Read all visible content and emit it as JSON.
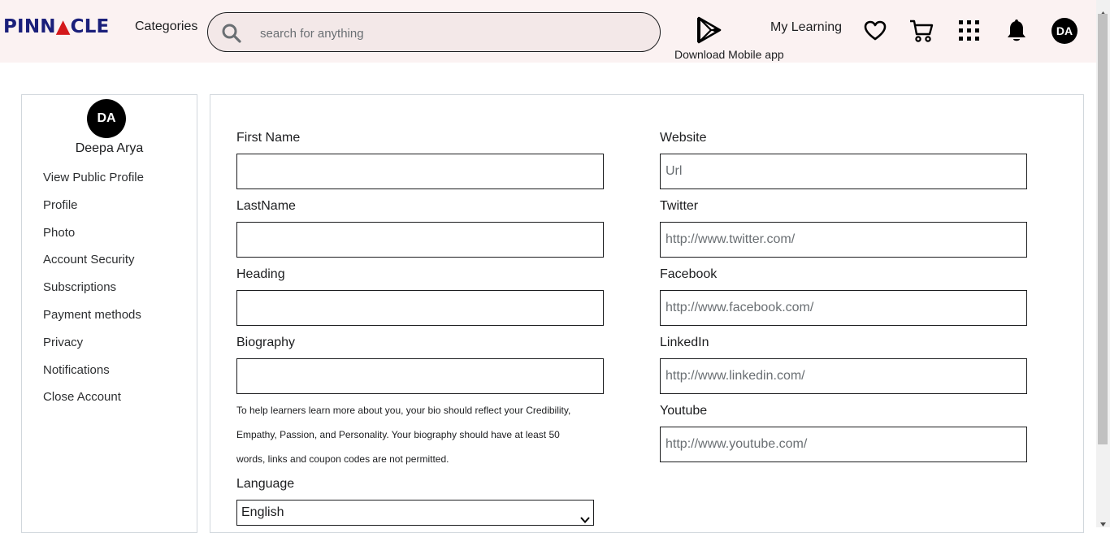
{
  "header": {
    "logo": {
      "left": "PINN",
      "mark": "▲",
      "right": "CLE"
    },
    "categories_label": "Categories",
    "search": {
      "placeholder": "search for anything",
      "value": ""
    },
    "download_app_label": "Download Mobile app",
    "my_learning_label": "My Learning",
    "avatar_initials": "DA",
    "icons": [
      "search-icon",
      "google-play-icon",
      "heart-icon",
      "cart-icon",
      "apps-grid-icon",
      "bell-icon"
    ]
  },
  "sidebar": {
    "avatar_initials": "DA",
    "user_name": "Deepa Arya",
    "items": [
      {
        "label": "View Public Profile"
      },
      {
        "label": "Profile"
      },
      {
        "label": "Photo"
      },
      {
        "label": "Account Security"
      },
      {
        "label": "Subscriptions"
      },
      {
        "label": "Payment methods"
      },
      {
        "label": "Privacy"
      },
      {
        "label": "Notifications"
      },
      {
        "label": "Close Account"
      }
    ]
  },
  "form": {
    "first_name": {
      "label": "First Name",
      "value": "",
      "placeholder": ""
    },
    "last_name": {
      "label": "LastName",
      "value": "",
      "placeholder": ""
    },
    "heading": {
      "label": "Heading",
      "value": "",
      "placeholder": ""
    },
    "biography": {
      "label": "Biography",
      "value": "",
      "placeholder": "",
      "help_lines": [
        "To help learners learn more about you, your bio should reflect your Credibility,",
        "Empathy, Passion, and Personality. Your biography should have at least 50",
        "words, links and coupon codes are not permitted."
      ]
    },
    "language": {
      "label": "Language",
      "selected": "English"
    },
    "website": {
      "label": "Website",
      "placeholder": "Url",
      "value": ""
    },
    "twitter": {
      "label": "Twitter",
      "placeholder": "http://www.twitter.com/",
      "value": ""
    },
    "facebook": {
      "label": "Facebook",
      "placeholder": "http://www.facebook.com/",
      "value": ""
    },
    "linkedin": {
      "label": "LinkedIn",
      "placeholder": "http://www.linkedin.com/",
      "value": ""
    },
    "youtube": {
      "label": "Youtube",
      "placeholder": "http://www.youtube.com/",
      "value": ""
    }
  },
  "colors": {
    "header_bg": "#fbf2f2",
    "search_bg": "#f3e8e8",
    "logo_blue": "#1a1f7a",
    "logo_red": "#d4191c",
    "border": "#d1d7dc"
  }
}
